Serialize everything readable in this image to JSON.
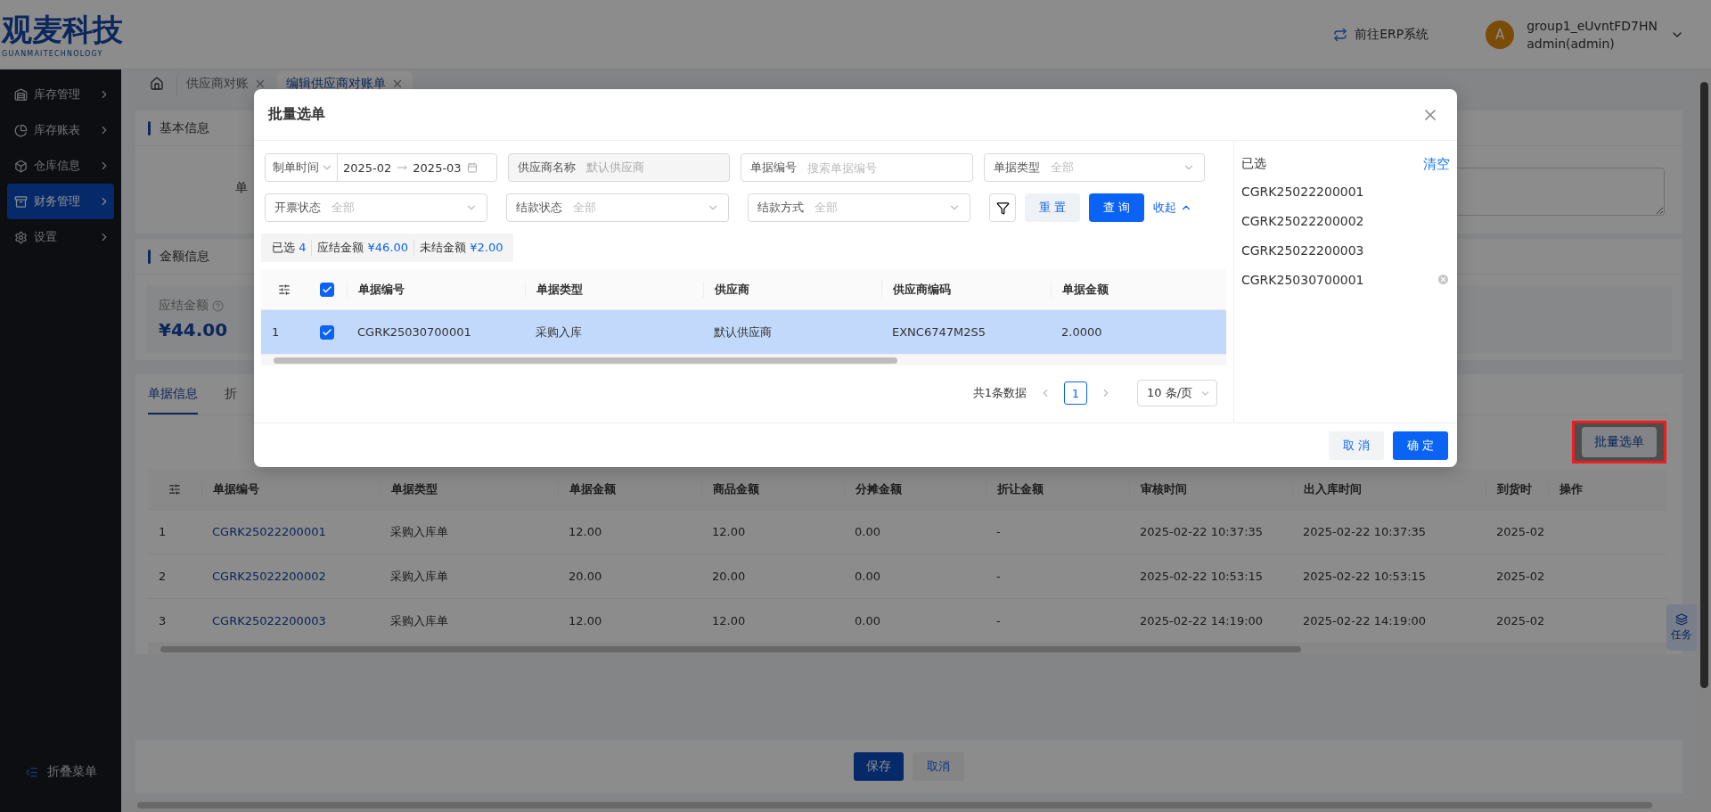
{
  "header": {
    "logo_title": "观麦科技",
    "logo_subtitle": "GUANMAITECHNOLOGY",
    "erp_link": "前往ERP系统",
    "user": {
      "avatar": "A",
      "name": "group1_eUvntFD7HN",
      "role": "admin(admin)"
    }
  },
  "sidebar": {
    "items": [
      {
        "label": "库存管理",
        "selected": false
      },
      {
        "label": "库存账表",
        "selected": false
      },
      {
        "label": "仓库信息",
        "selected": false
      },
      {
        "label": "财务管理",
        "selected": true
      },
      {
        "label": "设置",
        "selected": false
      }
    ],
    "collapse": "折叠菜单"
  },
  "page_tabs": [
    {
      "label": "供应商对账",
      "selected": false
    },
    {
      "label": "编辑供应商对账单",
      "selected": true
    }
  ],
  "basic_info": {
    "title": "基本信息",
    "field_label": "单"
  },
  "amount_info": {
    "title": "金额信息",
    "stats": [
      {
        "label": "应结金额",
        "value": "¥44.00"
      }
    ]
  },
  "detail": {
    "tabs": [
      {
        "label": "单据信息",
        "selected": true
      },
      {
        "label": "折",
        "selected": false
      }
    ],
    "batch_button": "批量选单",
    "table": {
      "columns": [
        "单据编号",
        "单据类型",
        "单据金额",
        "商品金额",
        "分摊金额",
        "折让金额",
        "审核时间",
        "出入库时间",
        "到货时",
        "操作"
      ],
      "rows": [
        {
          "index": "1",
          "cells": [
            "CGRK25022200001",
            "采购入库单",
            "12.00",
            "12.00",
            "0.00",
            "-",
            "2025-02-22 10:37:35",
            "2025-02-22 10:37:35",
            "2025-02",
            ""
          ]
        },
        {
          "index": "2",
          "cells": [
            "CGRK25022200002",
            "采购入库单",
            "20.00",
            "20.00",
            "0.00",
            "-",
            "2025-02-22 10:53:15",
            "2025-02-22 10:53:15",
            "2025-02",
            ""
          ]
        },
        {
          "index": "3",
          "cells": [
            "CGRK25022200003",
            "采购入库单",
            "12.00",
            "12.00",
            "0.00",
            "-",
            "2025-02-22 14:19:00",
            "2025-02-22 14:19:00",
            "2025-02",
            ""
          ]
        }
      ]
    }
  },
  "task_button": "任务",
  "footer": {
    "save": "保存",
    "cancel": "取消"
  },
  "modal": {
    "title": "批量选单",
    "filters": {
      "time_type": "制单时间",
      "date_start": "2025-02",
      "date_end": "2025-03",
      "supplier": {
        "label": "供应商名称",
        "value": "默认供应商",
        "disabled": true
      },
      "doc_no": {
        "label": "单据编号",
        "placeholder": "搜索单据编号"
      },
      "selects": [
        {
          "label": "单据类型",
          "placeholder": "全部"
        },
        {
          "label": "开票状态",
          "placeholder": "全部"
        },
        {
          "label": "结款状态",
          "placeholder": "全部"
        },
        {
          "label": "结款方式",
          "placeholder": "全部"
        }
      ],
      "reset": "重 置",
      "query": "查 询",
      "collapse": "收起"
    },
    "summary": [
      {
        "label": "已选",
        "value": "4"
      },
      {
        "label": "应结金额",
        "value": "¥46.00"
      },
      {
        "label": "未结金额",
        "value": "¥2.00"
      }
    ],
    "table": {
      "all_checked": true,
      "columns": [
        "单据编号",
        "单据类型",
        "供应商",
        "供应商编码",
        "单据金额"
      ],
      "rows": [
        {
          "index": "1",
          "checked": true,
          "selected": true,
          "cells": [
            "CGRK25030700001",
            "采购入库",
            "默认供应商",
            "EXNC6747M2S5",
            "2.0000"
          ]
        }
      ]
    },
    "pagination": {
      "total": "共1条数据",
      "pages": [
        {
          "label": "1",
          "selected": true
        }
      ],
      "page_size": "10 条/页"
    },
    "selected_panel": {
      "title": "已选",
      "clear": "清空",
      "items": [
        {
          "label": "CGRK25022200001",
          "removable": false
        },
        {
          "label": "CGRK25022200002",
          "removable": false
        },
        {
          "label": "CGRK25022200003",
          "removable": false
        },
        {
          "label": "CGRK25030700001",
          "removable": true
        }
      ]
    },
    "cancel": "取 消",
    "confirm": "确 定"
  }
}
